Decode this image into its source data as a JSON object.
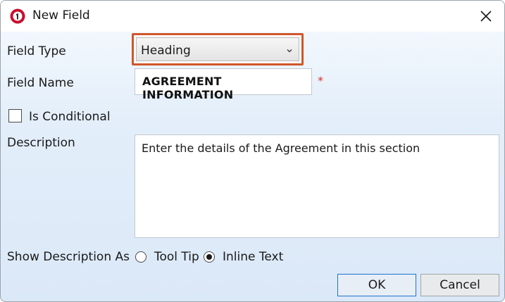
{
  "window": {
    "title": "New Field"
  },
  "icons": {
    "app": "app-logo-icon",
    "close": "close-icon",
    "dropdown": "chevron-down-icon"
  },
  "colors": {
    "highlight": "#d0562a",
    "required": "#d93025",
    "accent": "#1b74d1"
  },
  "form": {
    "field_type": {
      "label": "Field Type",
      "value": "Heading"
    },
    "field_name": {
      "label": "Field Name",
      "value": "AGREEMENT INFORMATION",
      "required_marker": "*"
    },
    "is_conditional": {
      "label": "Is Conditional",
      "checked": false
    },
    "description": {
      "label": "Description",
      "value": "Enter the details of the Agreement in this section"
    },
    "show_description_as": {
      "label": "Show Description As",
      "options": [
        {
          "label": "Tool Tip",
          "selected": false
        },
        {
          "label": "Inline Text",
          "selected": true
        }
      ]
    }
  },
  "buttons": {
    "ok": "OK",
    "cancel": "Cancel"
  }
}
